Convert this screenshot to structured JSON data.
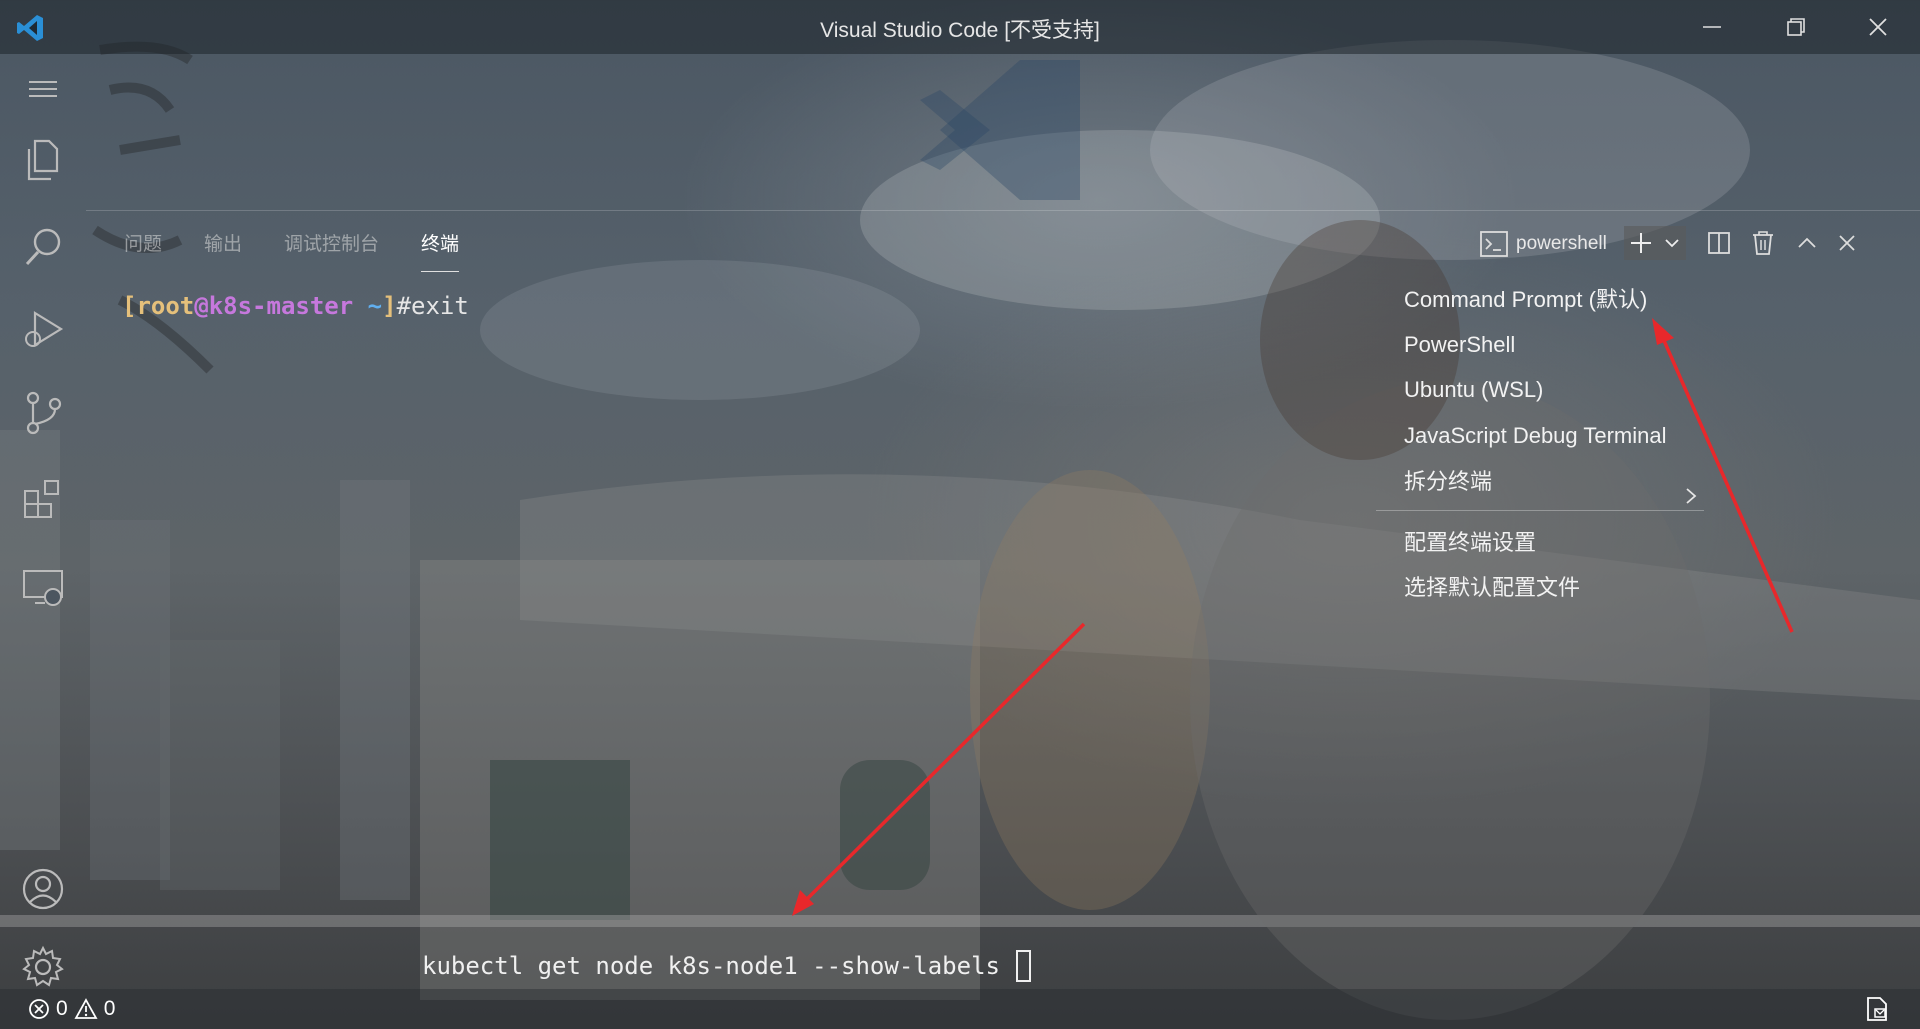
{
  "titlebar": {
    "title": "Visual Studio Code [不受支持]"
  },
  "activitybar": {
    "items": [
      "menu-icon",
      "explorer-icon",
      "search-icon",
      "run-debug-icon",
      "source-control-icon",
      "extensions-icon",
      "remote-explorer-icon",
      "account-icon",
      "settings-gear-icon"
    ]
  },
  "panel": {
    "tabs": [
      {
        "label": "问题",
        "active": false
      },
      {
        "label": "输出",
        "active": false
      },
      {
        "label": "调试控制台",
        "active": false
      },
      {
        "label": "终端",
        "active": true
      }
    ],
    "terminal_name": "powershell"
  },
  "terminal": {
    "prompt": {
      "open": "[",
      "user": "root",
      "at": "@",
      "host": "k8s-master",
      "cwd": " ~",
      "close": "]",
      "symbol": "#",
      "command": "exit"
    },
    "pending_command": "kubectl get node k8s-node1 --show-labels"
  },
  "dropdown": {
    "items": [
      {
        "label": "Command Prompt (默认)"
      },
      {
        "label": "PowerShell"
      },
      {
        "label": "Ubuntu (WSL)"
      },
      {
        "label": "JavaScript Debug Terminal"
      },
      {
        "label": "拆分终端",
        "submenu": true
      }
    ],
    "config_items": [
      {
        "label": "配置终端设置"
      },
      {
        "label": "选择默认配置文件"
      }
    ]
  },
  "statusbar": {
    "errors": "0",
    "warnings": "0"
  },
  "colors": {
    "annotation_arrow": "#e8282b",
    "prompt_user": "#e5c07b",
    "prompt_host": "#c678dd",
    "prompt_cwd": "#61afef"
  }
}
